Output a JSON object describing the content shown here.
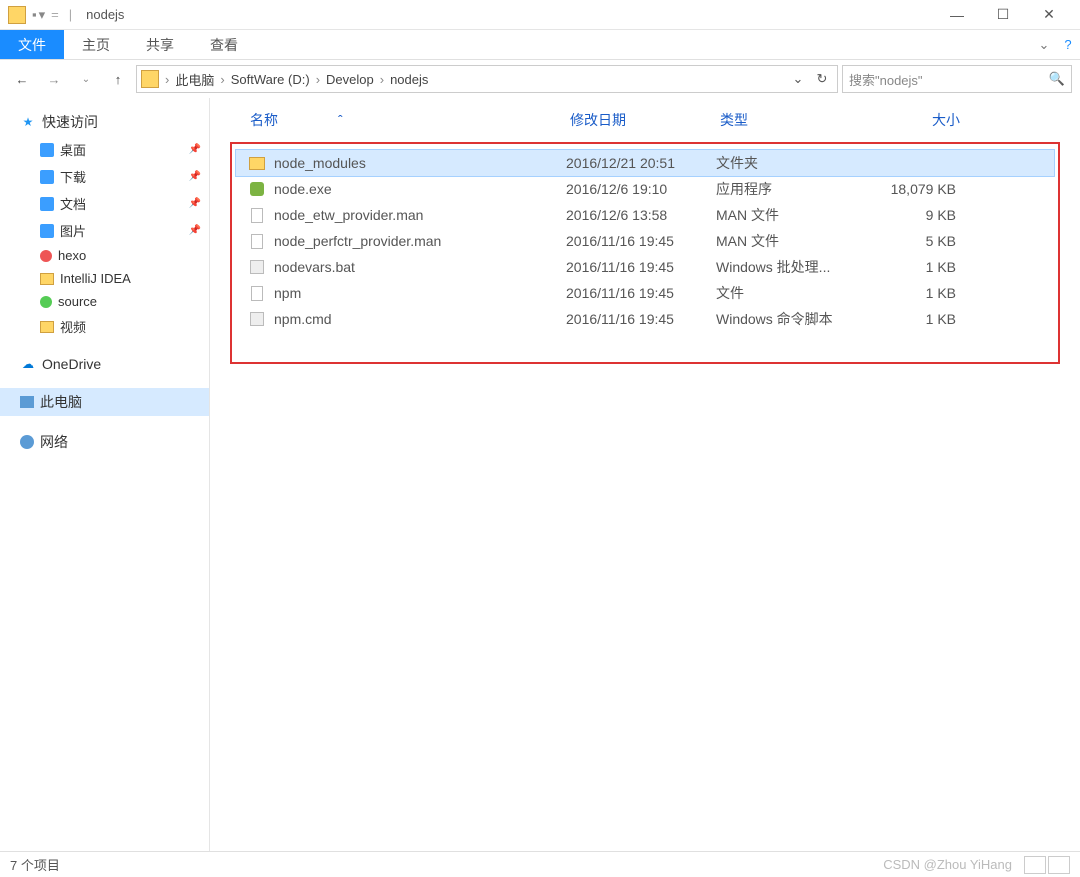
{
  "titlebar": {
    "title": "nodejs"
  },
  "ribbon": {
    "file": "文件",
    "home": "主页",
    "share": "共享",
    "view": "查看"
  },
  "breadcrumb": {
    "items": [
      "此电脑",
      "SoftWare (D:)",
      "Develop",
      "nodejs"
    ]
  },
  "search": {
    "placeholder": "搜索\"nodejs\""
  },
  "sidebar": {
    "quick_access": "快速访问",
    "items": [
      {
        "label": "桌面",
        "pinned": true,
        "icon": "blue"
      },
      {
        "label": "下载",
        "pinned": true,
        "icon": "blue"
      },
      {
        "label": "文档",
        "pinned": true,
        "icon": "blue"
      },
      {
        "label": "图片",
        "pinned": true,
        "icon": "blue"
      },
      {
        "label": "hexo",
        "pinned": false,
        "icon": "red"
      },
      {
        "label": "IntelliJ IDEA",
        "pinned": false,
        "icon": "folder"
      },
      {
        "label": "source",
        "pinned": false,
        "icon": "green"
      },
      {
        "label": "视频",
        "pinned": false,
        "icon": "folder"
      }
    ],
    "onedrive": "OneDrive",
    "this_pc": "此电脑",
    "network": "网络"
  },
  "columns": {
    "name": "名称",
    "date": "修改日期",
    "type": "类型",
    "size": "大小"
  },
  "files": [
    {
      "name": "node_modules",
      "date": "2016/12/21 20:51",
      "type": "文件夹",
      "size": "",
      "icon": "folder",
      "selected": true
    },
    {
      "name": "node.exe",
      "date": "2016/12/6 19:10",
      "type": "应用程序",
      "size": "18,079 KB",
      "icon": "exe"
    },
    {
      "name": "node_etw_provider.man",
      "date": "2016/12/6 13:58",
      "type": "MAN 文件",
      "size": "9 KB",
      "icon": "file"
    },
    {
      "name": "node_perfctr_provider.man",
      "date": "2016/11/16 19:45",
      "type": "MAN 文件",
      "size": "5 KB",
      "icon": "file"
    },
    {
      "name": "nodevars.bat",
      "date": "2016/11/16 19:45",
      "type": "Windows 批处理...",
      "size": "1 KB",
      "icon": "bat"
    },
    {
      "name": "npm",
      "date": "2016/11/16 19:45",
      "type": "文件",
      "size": "1 KB",
      "icon": "file"
    },
    {
      "name": "npm.cmd",
      "date": "2016/11/16 19:45",
      "type": "Windows 命令脚本",
      "size": "1 KB",
      "icon": "bat"
    }
  ],
  "status": {
    "count": "7 个项目",
    "watermark": "CSDN @Zhou YiHang"
  }
}
